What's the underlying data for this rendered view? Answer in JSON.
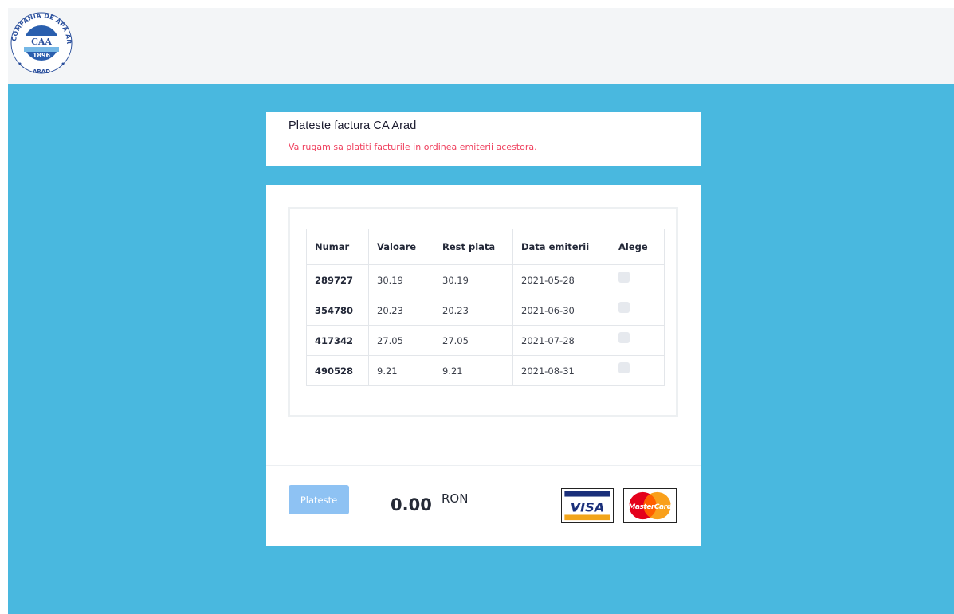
{
  "header": {
    "logo": {
      "icon": "company-logo-icon",
      "ring_text": "COMPANIA DE APĂ ARAD SA",
      "initials": "CAA",
      "year": "1896",
      "bottom_text": "ARAD"
    }
  },
  "title_card": {
    "title": "Plateste factura CA Arad",
    "notice": "Va rugam sa platiti facturile in ordinea emiterii acestora."
  },
  "invoices": {
    "columns": [
      "Numar",
      "Valoare",
      "Rest plata",
      "Data emiterii",
      "Alege"
    ],
    "rows": [
      {
        "numar": "289727",
        "valoare": "30.19",
        "rest": "30.19",
        "data": "2021-05-28",
        "selected": false
      },
      {
        "numar": "354780",
        "valoare": "20.23",
        "rest": "20.23",
        "data": "2021-06-30",
        "selected": false
      },
      {
        "numar": "417342",
        "valoare": "27.05",
        "rest": "27.05",
        "data": "2021-07-28",
        "selected": false
      },
      {
        "numar": "490528",
        "valoare": "9.21",
        "rest": "9.21",
        "data": "2021-08-31",
        "selected": false
      }
    ]
  },
  "payment": {
    "button_label": "Plateste",
    "amount": "0.00",
    "currency": "RON",
    "cards": [
      {
        "name": "VISA",
        "icon": "visa-icon"
      },
      {
        "name": "MasterCard",
        "icon": "mastercard-icon"
      }
    ]
  },
  "colors": {
    "page_bg": "#49b8df",
    "header_bg": "#f3f5f7",
    "notice": "#ef3e5c",
    "button": "#8ec2f3"
  }
}
